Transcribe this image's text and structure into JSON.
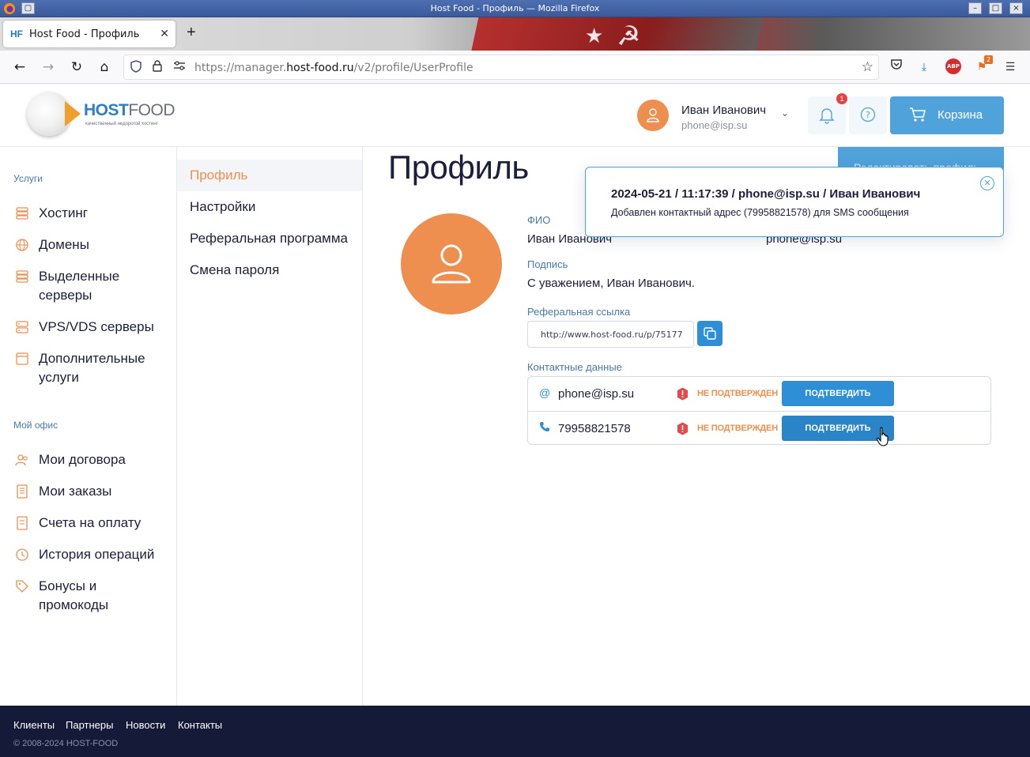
{
  "window": {
    "title": "Host Food - Профиль — Mozilla Firefox"
  },
  "browser": {
    "tab_label": "Host Food - Профиль",
    "tab_favicon_text": "HF",
    "url_prefix": "https://manager.",
    "url_domain": "host-food.ru",
    "url_path": "/v2/profile/UserProfile",
    "abp_label": "ABP",
    "ext_badge": "2"
  },
  "header": {
    "logo_host": "HOST",
    "logo_food": "FOOD",
    "logo_slogan": "качественный недорогой хостинг",
    "user_name": "Иван Иванович",
    "user_email": "phone@isp.su",
    "notifications_count": "1",
    "cart_label": "Корзина"
  },
  "sidebar": {
    "services_heading": "Услуги",
    "services": [
      {
        "label": "Хостинг",
        "icon": "server-stack-icon"
      },
      {
        "label": "Домены",
        "icon": "globe-icon"
      },
      {
        "label": "Выделенные серверы",
        "icon": "server-stack-icon"
      },
      {
        "label": "VPS/VDS серверы",
        "icon": "vps-icon"
      },
      {
        "label": "Дополнительные услуги",
        "icon": "window-icon"
      }
    ],
    "office_heading": "Мой офис",
    "office": [
      {
        "label": "Мои договора",
        "icon": "users-icon"
      },
      {
        "label": "Мои заказы",
        "icon": "document-icon"
      },
      {
        "label": "Счета на оплату",
        "icon": "invoice-icon"
      },
      {
        "label": "История операций",
        "icon": "history-icon"
      },
      {
        "label": "Бонусы и промокоды",
        "icon": "tag-icon"
      }
    ]
  },
  "subnav": {
    "items": [
      {
        "label": "Профиль",
        "active": true
      },
      {
        "label": "Настройки",
        "active": false
      },
      {
        "label": "Реферальная программа",
        "active": false
      },
      {
        "label": "Смена пароля",
        "active": false
      }
    ]
  },
  "profile": {
    "title": "Профиль",
    "edit_label": "Редактировать профиль",
    "fio_label": "ФИО",
    "fio_value": "Иван Иванович",
    "email_value": "phone@isp.su",
    "signature_label": "Подпись",
    "signature_value": "С уважением, Иван Иванович.",
    "referral_label": "Реферальная ссылка",
    "referral_value": "http://www.host-food.ru/p/75177/",
    "contacts_label": "Контактные данные",
    "contacts": [
      {
        "icon": "at-icon",
        "value": "phone@isp.su",
        "status": "НЕ ПОДТВЕРЖДЕН",
        "button": "ПОДТВЕРДИТЬ"
      },
      {
        "icon": "phone-icon",
        "value": "79958821578",
        "status": "НЕ ПОДТВЕРЖДЕН",
        "button": "ПОДТВЕРДИТЬ"
      }
    ]
  },
  "toast": {
    "title": "2024-05-21 / 11:17:39 / phone@isp.su / Иван Иванович",
    "body": "Добавлен контактный адрес (79958821578) для SMS сообщения"
  },
  "footer": {
    "links": [
      "Клиенты",
      "Партнеры",
      "Новости",
      "Контакты"
    ],
    "copyright": "© 2008-2024 HOST-FOOD"
  },
  "colors": {
    "accent_orange": "#ee8f4f",
    "accent_blue": "#4fa3da",
    "button_blue": "#2e8fd6",
    "footer_bg": "#141a38"
  }
}
